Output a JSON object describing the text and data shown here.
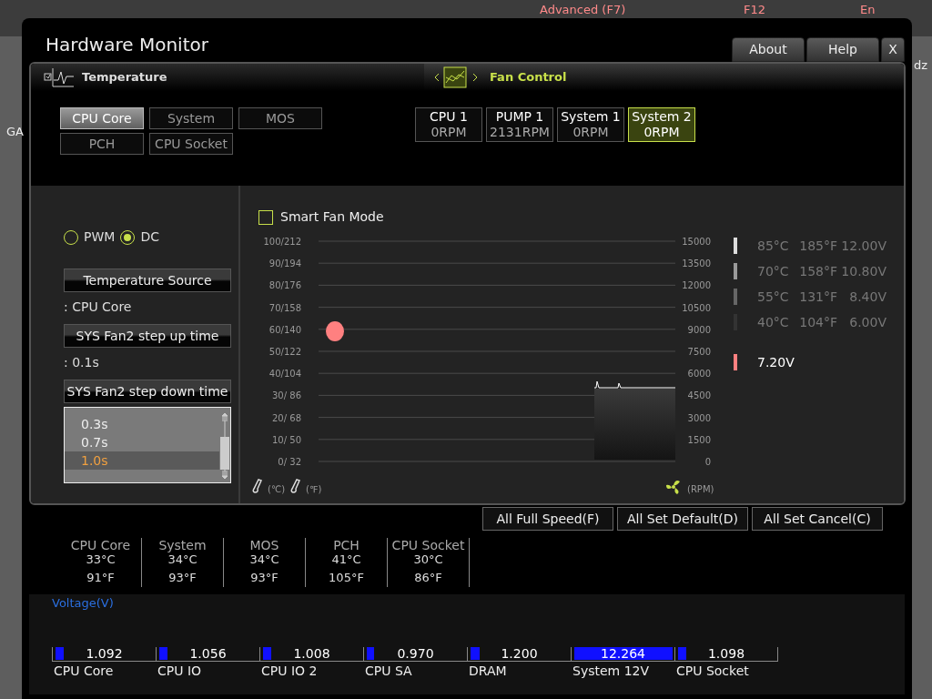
{
  "background": {
    "mode_label": "Advanced (F7)",
    "key_hint": "F12",
    "language": "En",
    "left_tab": "GA",
    "right_edge": "dz"
  },
  "window": {
    "title": "Hardware Monitor",
    "buttons": [
      "About",
      "Help",
      "X"
    ]
  },
  "temperature_panel": {
    "title": "Temperature",
    "sensors": [
      {
        "label": "CPU Core",
        "selected": true
      },
      {
        "label": "System",
        "selected": false
      },
      {
        "label": "MOS",
        "selected": false
      },
      {
        "label": "PCH",
        "selected": false
      },
      {
        "label": "CPU Socket",
        "selected": false
      }
    ]
  },
  "fan_control": {
    "title": "Fan Control",
    "fans": [
      {
        "name": "CPU 1",
        "reading": "0RPM",
        "selected": false
      },
      {
        "name": "PUMP 1",
        "reading": "2131RPM",
        "selected": false
      },
      {
        "name": "System 1",
        "reading": "0RPM",
        "selected": false
      },
      {
        "name": "System 2",
        "reading": "0RPM",
        "selected": true
      }
    ]
  },
  "fan_mode": [
    {
      "label": "PWM",
      "selected": false
    },
    {
      "label": "DC",
      "selected": true
    }
  ],
  "settings": [
    {
      "kind": "value",
      "heading": "Temperature Source",
      "value": ": CPU Core"
    },
    {
      "kind": "value",
      "heading": "SYS Fan2 step up time",
      "value": ": 0.1s"
    },
    {
      "kind": "list",
      "heading": "SYS Fan2 step down time",
      "options": [
        {
          "label": "0.3s",
          "selected": false
        },
        {
          "label": "0.7s",
          "selected": false
        },
        {
          "label": "1.0s",
          "selected": true
        }
      ]
    }
  ],
  "smart_fan": {
    "label": "Smart Fan Mode",
    "checked": false
  },
  "fan_chart": {
    "left_ticks": [
      "100/212",
      "90/194",
      "80/176",
      "70/158",
      "60/140",
      "50/122",
      "40/104",
      "30/ 86",
      "20/ 68",
      "10/ 50",
      "0/ 32"
    ],
    "right_ticks": [
      "15000",
      "13500",
      "12000",
      "10500",
      "9000",
      "7500",
      "6000",
      "4500",
      "3000",
      "1500",
      "0"
    ],
    "units": [
      "(℃)",
      "(℉)",
      "(RPM)"
    ]
  },
  "fan_points": [
    {
      "celsius": "85°C",
      "fahrenheit": "185°F",
      "voltage": "12.00V",
      "color": "#dddddd"
    },
    {
      "celsius": "70°C",
      "fahrenheit": "158°F",
      "voltage": "10.80V",
      "color": "#9a9a9a"
    },
    {
      "celsius": "55°C",
      "fahrenheit": "131°F",
      "voltage": "8.40V",
      "color": "#666666"
    },
    {
      "celsius": "40°C",
      "fahrenheit": "104°F",
      "voltage": "6.00V",
      "color": "#333333"
    }
  ],
  "current": {
    "voltage": "7.20V",
    "color": "#ff8080"
  },
  "actions": [
    "All Full Speed(F)",
    "All Set Default(D)",
    "All Set Cancel(C)"
  ],
  "temperatures": [
    {
      "name": "CPU Core",
      "celsius": "33°C",
      "fahrenheit": "91°F"
    },
    {
      "name": "System",
      "celsius": "34°C",
      "fahrenheit": "93°F"
    },
    {
      "name": "MOS",
      "celsius": "34°C",
      "fahrenheit": "93°F"
    },
    {
      "name": "PCH",
      "celsius": "41°C",
      "fahrenheit": "105°F"
    },
    {
      "name": "CPU Socket",
      "celsius": "30°C",
      "fahrenheit": "86°F"
    }
  ],
  "voltage": {
    "title": "Voltage(V)",
    "items": [
      {
        "name": "CPU Core",
        "value": "1.092",
        "level": 0.08
      },
      {
        "name": "CPU IO",
        "value": "1.056",
        "level": 0.08
      },
      {
        "name": "CPU IO 2",
        "value": "1.008",
        "level": 0.08
      },
      {
        "name": "CPU SA",
        "value": "0.970",
        "level": 0.07
      },
      {
        "name": "DRAM",
        "value": "1.200",
        "level": 0.09
      },
      {
        "name": "System 12V",
        "value": "12.264",
        "level": 0.96
      },
      {
        "name": "CPU Socket",
        "value": "1.098",
        "level": 0.08
      }
    ]
  }
}
